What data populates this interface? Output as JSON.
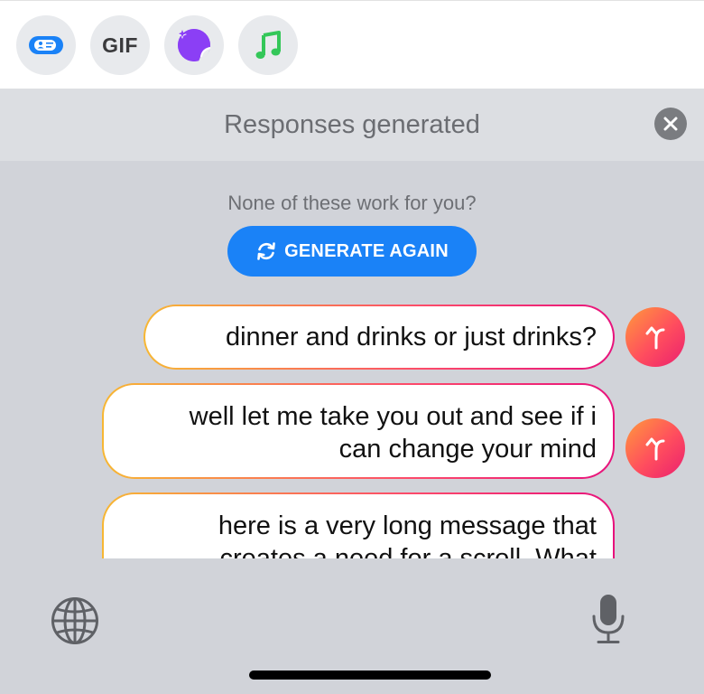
{
  "app_strip": {
    "apps": [
      {
        "name": "contact-card-app",
        "icon": "contact-card-icon"
      },
      {
        "name": "gif-app",
        "label": "GIF"
      },
      {
        "name": "sticker-app",
        "icon": "sticker-icon"
      },
      {
        "name": "music-app",
        "icon": "music-note-icon"
      }
    ]
  },
  "panel": {
    "title": "Responses generated"
  },
  "responses": {
    "prompt": "None of these work for you?",
    "generate_label": "GENERATE AGAIN",
    "items": [
      {
        "lines": [
          "dinner and drinks or just drinks?"
        ]
      },
      {
        "lines": [
          "well let me take you out and see if i",
          "can change your mind"
        ]
      },
      {
        "lines": [
          "here is a very long message that",
          "creates a need for a scroll. What"
        ]
      }
    ]
  },
  "colors": {
    "accent_blue": "#1a82f7",
    "bubble_gradient": [
      "#f7b733",
      "#fc4a6a",
      "#e8127c"
    ],
    "music_green": "#34c759",
    "sticker_purple": "#8b3ff5"
  }
}
